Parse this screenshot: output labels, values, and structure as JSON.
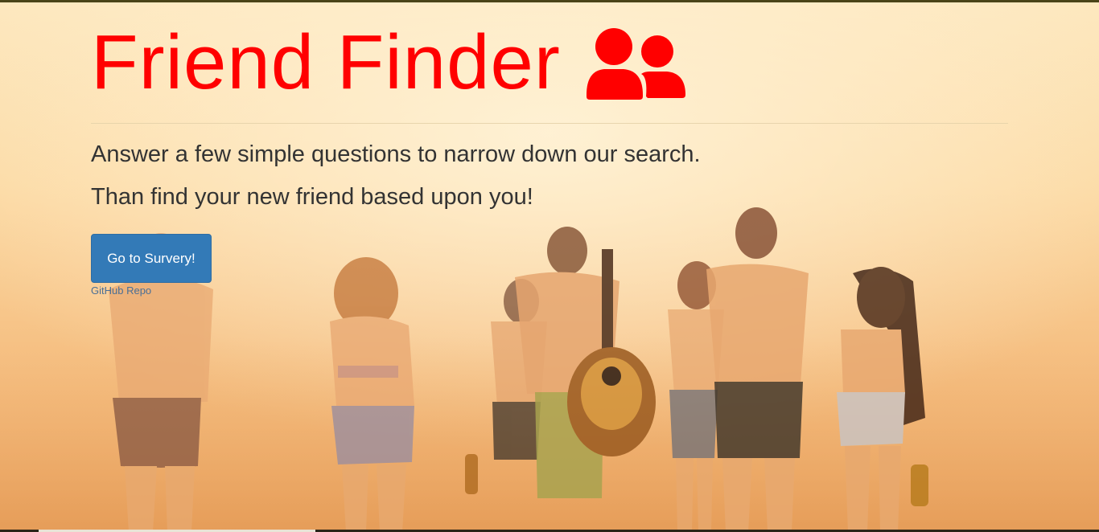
{
  "header": {
    "title": "Friend Finder",
    "title_icon": "users-icon",
    "title_color": "#ff0000"
  },
  "intro": {
    "line1": "Answer a few simple questions to narrow down our search.",
    "line2": "Than find your new friend based upon you!"
  },
  "actions": {
    "survey_button_label": "Go to Survery!",
    "survey_button_color": "#337ab7",
    "repo_link_label": "GitHub Repo"
  },
  "background": {
    "image_subject": "group of friends walking on a beach at sunset"
  }
}
